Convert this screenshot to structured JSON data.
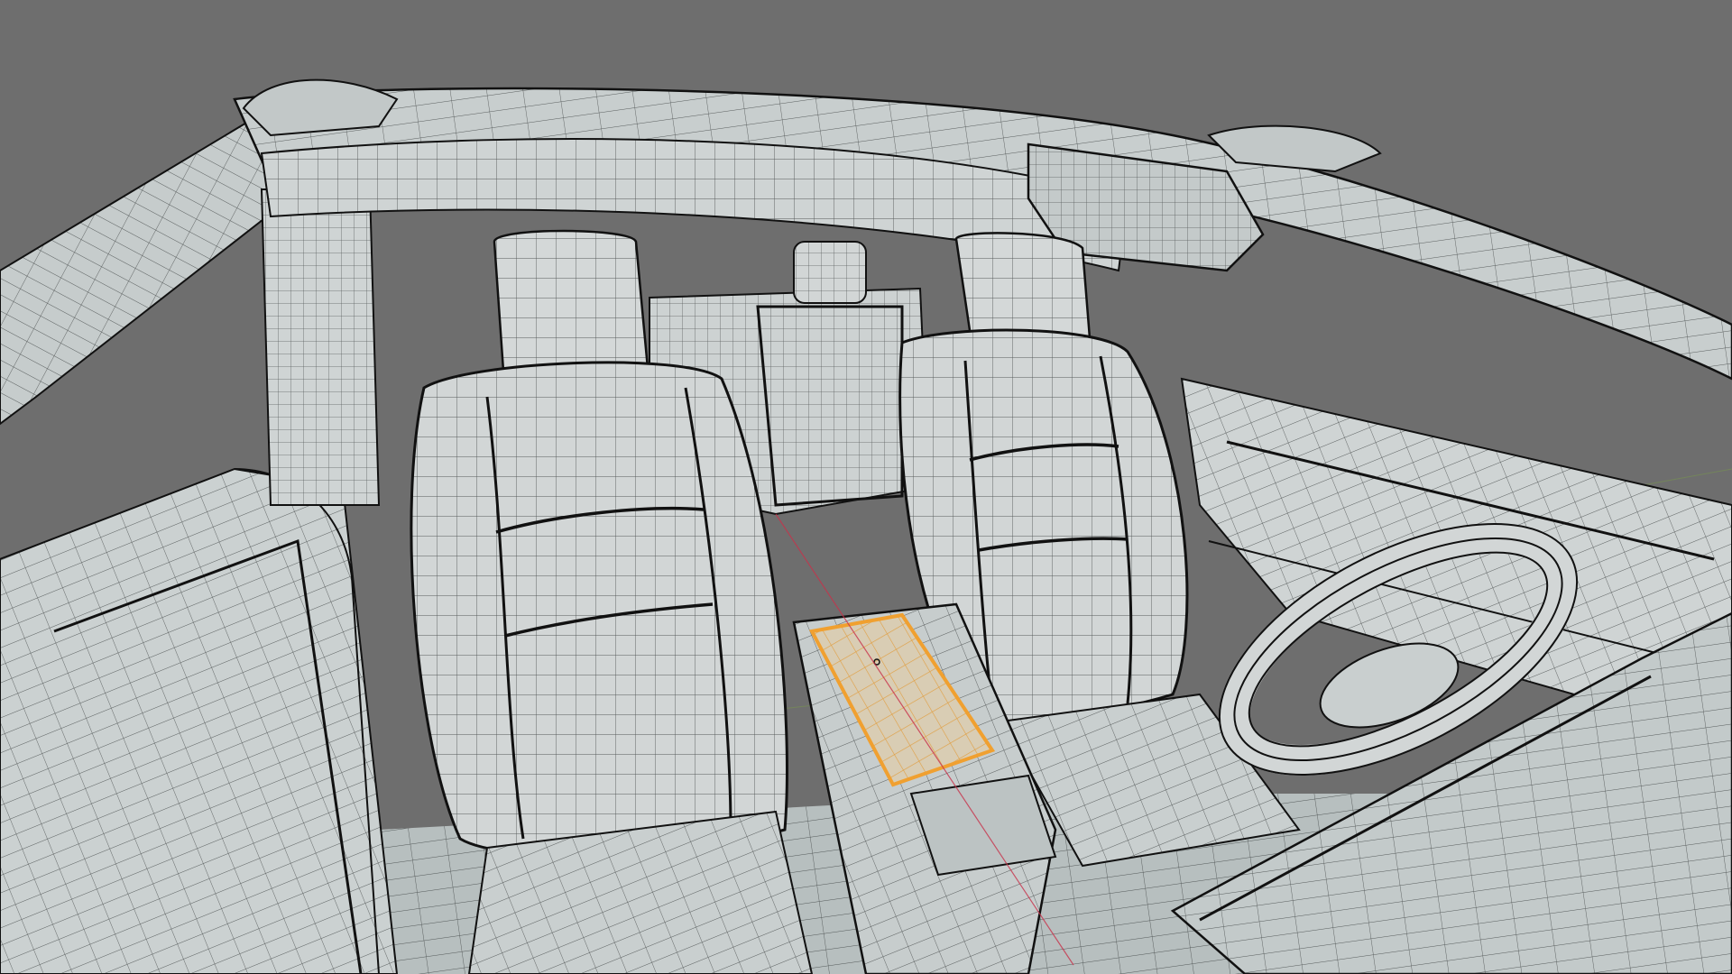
{
  "viewport": {
    "background": "#6e6e6e",
    "mode": "3d-viewport-wireframe-overlay",
    "selected_object": "center-console-armrest",
    "selection_color": "#f0a030",
    "mesh_fill": "#d4d8d8",
    "mesh_shade": "#b9c1c1",
    "wire_color": "#2a2e2e",
    "edge_color": "#111111",
    "axis_x_color": "#c8324a",
    "axis_y_color": "#7fae3a"
  },
  "scene": {
    "objects": [
      "roof-frame",
      "roof-cross-beam",
      "rear-view-mirror",
      "a-pillar-left",
      "a-pillar-right",
      "rear-bench",
      "rear-headrest",
      "front-seat-left",
      "front-seat-right",
      "center-console",
      "center-console-armrest",
      "steering-wheel",
      "dashboard",
      "left-door-panel",
      "right-door-panel",
      "floor"
    ]
  }
}
